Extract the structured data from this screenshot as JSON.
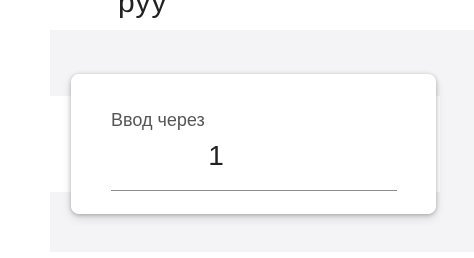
{
  "background": {
    "top_fragment_text": "руу"
  },
  "dialog": {
    "field": {
      "label": "Ввод через",
      "value": "1"
    },
    "colors": {
      "surface": "#ffffff",
      "label": "#555555",
      "underline": "#8a8a8a"
    }
  }
}
